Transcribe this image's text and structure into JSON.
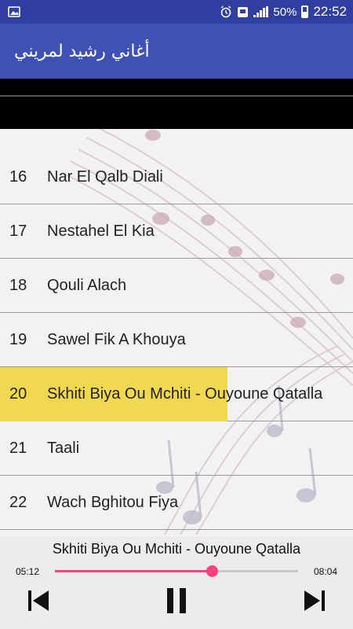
{
  "status_bar": {
    "battery_percent": "50%",
    "time": "22:52",
    "icons": [
      "image-icon",
      "alarm-icon",
      "cast-icon",
      "signal-icon",
      "battery-icon"
    ]
  },
  "app_bar": {
    "title": "أغاني رشيد لمريني"
  },
  "tracks": [
    {
      "num": "16",
      "title": "Nar El Qalb Diali"
    },
    {
      "num": "17",
      "title": "Nestahel El Kia"
    },
    {
      "num": "18",
      "title": "Qouli Alach"
    },
    {
      "num": "19",
      "title": "Sawel Fik A Khouya"
    },
    {
      "num": "20",
      "title": "Skhiti Biya Ou Mchiti - Ouyoune Qatalla",
      "active": true
    },
    {
      "num": "21",
      "title": "Taali"
    },
    {
      "num": "22",
      "title": "Wach Bghitou Fiya"
    }
  ],
  "player": {
    "now_playing": "Skhiti Biya Ou Mchiti - Ouyoune Qatalla",
    "current_time": "05:12",
    "duration": "08:04",
    "progress": 0.645,
    "icons": [
      "previous-icon",
      "pause-icon",
      "next-icon"
    ]
  },
  "colors": {
    "status_bar": "#303f9f",
    "app_bar": "#3f51b5",
    "highlight": "#f0d850",
    "accent": "#ff4081"
  }
}
